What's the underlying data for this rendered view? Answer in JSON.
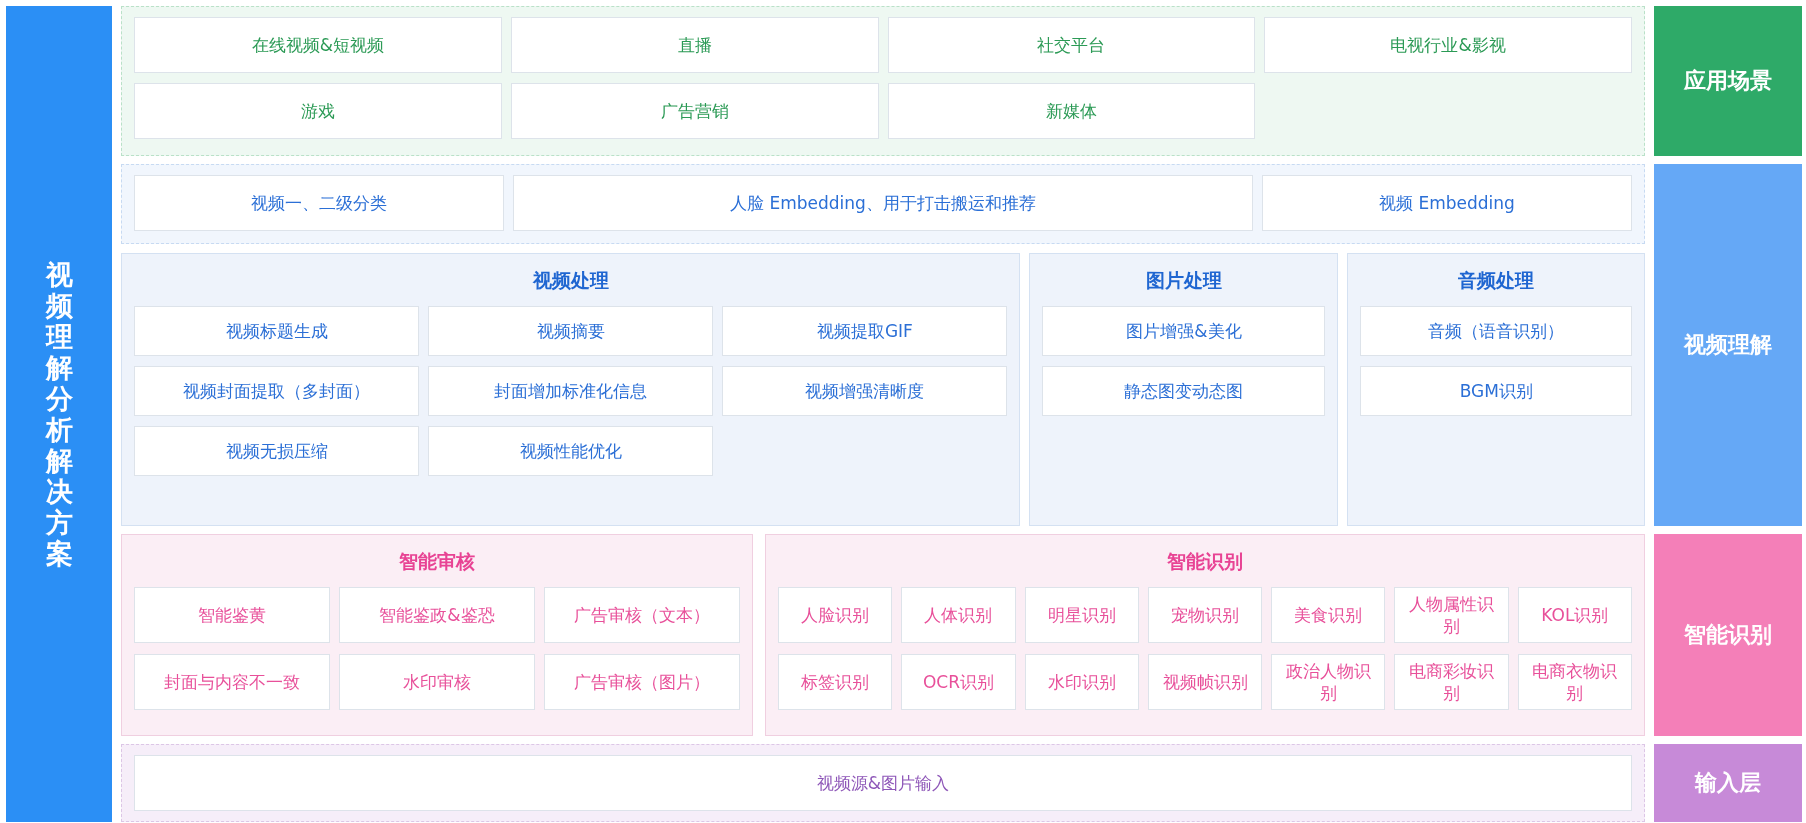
{
  "sidebar_title": "视频理解分析解决方案",
  "scenes": {
    "label": "应用场景",
    "items": [
      "在线视频&短视频",
      "直播",
      "社交平台",
      "电视行业&影视",
      "游戏",
      "广告营销",
      "新媒体"
    ]
  },
  "understanding": {
    "label": "视频理解",
    "top_items": [
      "视频一、二级分类",
      "人脸 Embedding、用于打击搬运和推荐",
      "视频 Embedding"
    ],
    "panels": [
      {
        "title": "视频处理",
        "items": [
          "视频标题生成",
          "视频摘要",
          "视频提取GIF",
          "视频封面提取（多封面）",
          "封面增加标准化信息",
          "视频增强清晰度",
          "视频无损压缩",
          "视频性能优化"
        ]
      },
      {
        "title": "图片处理",
        "items": [
          "图片增强&美化",
          "静态图变动态图"
        ]
      },
      {
        "title": "音频处理",
        "items": [
          "音频（语音识别）",
          "BGM识别"
        ]
      }
    ]
  },
  "recognition": {
    "label": "智能识别",
    "panels": [
      {
        "title": "智能审核",
        "items": [
          "智能鉴黄",
          "智能鉴政&鉴恐",
          "广告审核（文本）",
          "封面与内容不一致",
          "水印审核",
          "广告审核（图片）"
        ]
      },
      {
        "title": "智能识别",
        "items": [
          "人脸识别",
          "人体识别",
          "明星识别",
          "宠物识别",
          "美食识别",
          "人物属性识别",
          "KOL识别",
          "标签识别",
          "OCR识别",
          "水印识别",
          "视频帧识别",
          "政治人物识别",
          "电商彩妆识别",
          "电商衣物识别"
        ]
      }
    ]
  },
  "input": {
    "label": "输入层",
    "item": "视频源&图片输入"
  }
}
